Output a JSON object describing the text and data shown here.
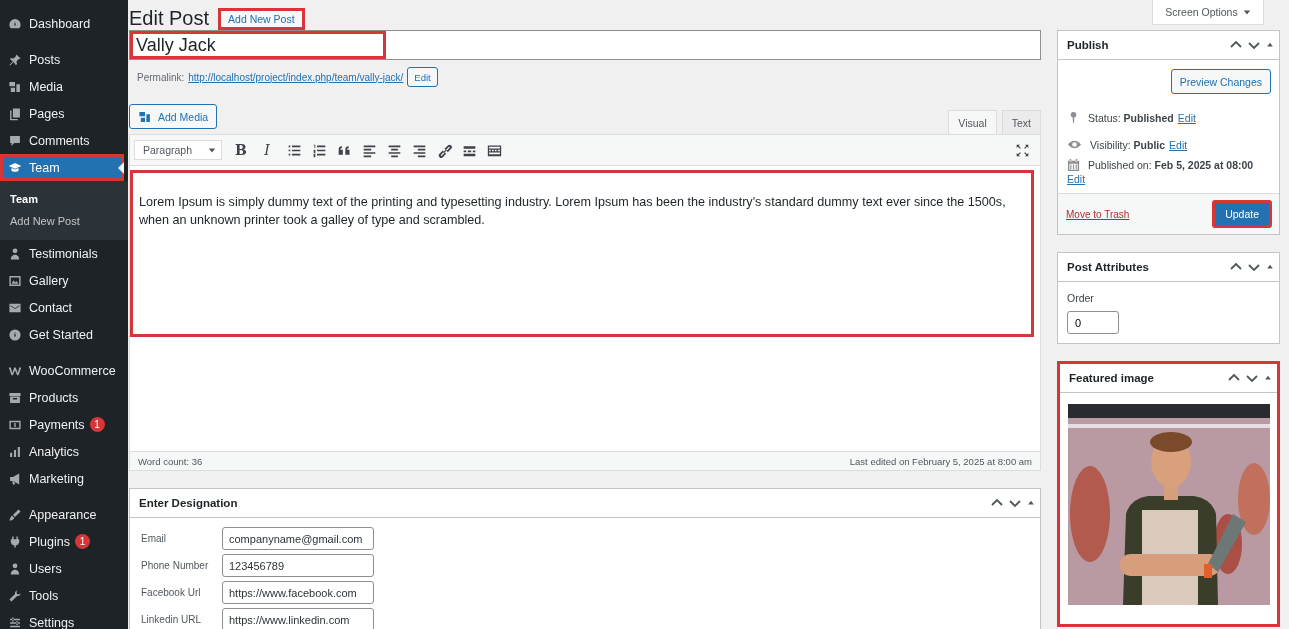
{
  "sidebar": {
    "groups": [
      [
        {
          "label": "Dashboard",
          "selected": false
        }
      ],
      [
        {
          "label": "Posts",
          "selected": false
        },
        {
          "label": "Media",
          "selected": false
        },
        {
          "label": "Pages",
          "selected": false
        },
        {
          "label": "Comments",
          "selected": false
        },
        {
          "label": "Team",
          "selected": true,
          "highlighted": true,
          "children": [
            {
              "label": "Team",
              "selected": true
            },
            {
              "label": "Add New Post",
              "selected": false
            }
          ]
        },
        {
          "label": "Testimonials",
          "selected": false
        },
        {
          "label": "Gallery",
          "selected": false
        },
        {
          "label": "Contact",
          "selected": false
        },
        {
          "label": "Get Started",
          "selected": false
        }
      ],
      [
        {
          "label": "WooCommerce",
          "selected": false
        },
        {
          "label": "Products",
          "selected": false
        },
        {
          "label": "Payments",
          "selected": false,
          "badge": "1"
        },
        {
          "label": "Analytics",
          "selected": false
        },
        {
          "label": "Marketing",
          "selected": false
        }
      ],
      [
        {
          "label": "Appearance",
          "selected": false
        },
        {
          "label": "Plugins",
          "selected": false,
          "badge": "1"
        },
        {
          "label": "Users",
          "selected": false
        },
        {
          "label": "Tools",
          "selected": false
        },
        {
          "label": "Settings",
          "selected": false
        }
      ]
    ]
  },
  "header": {
    "title": "Edit Post",
    "add_new": {
      "label": "Add New Post",
      "highlighted": true
    },
    "screen_options": "Screen Options"
  },
  "title_field": {
    "value": "Vally Jack",
    "highlighted": true
  },
  "permalink": {
    "label": "Permalink:",
    "url": "http://localhost/project/index.php/team/vally-jack/",
    "edit": "Edit"
  },
  "add_media": "Add Media",
  "editor_tabs": [
    {
      "label": "Visual",
      "selected": true
    },
    {
      "label": "Text",
      "selected": false
    }
  ],
  "toolbar": {
    "format": "Paragraph",
    "bold": "B",
    "italic": "I"
  },
  "content": {
    "text": "Lorem Ipsum is simply dummy text of the printing and typesetting industry. Lorem Ipsum has been the industry's standard dummy text ever since the 1500s, when an unknown printer took a galley of type and scrambled.",
    "highlighted": true
  },
  "status_bar": {
    "word_count": "Word count: 36",
    "last_edited": "Last edited on February 5, 2025 at 8:00 am"
  },
  "designation": {
    "title": "Enter Designation",
    "fields": [
      {
        "label": "Email",
        "value": "companyname@gmail.com"
      },
      {
        "label": "Phone Number",
        "value": "123456789"
      },
      {
        "label": "Facebook Url",
        "value": "https://www.facebook.com"
      },
      {
        "label": "Linkedin URL",
        "value": "https://www.linkedin.com"
      }
    ]
  },
  "publish": {
    "title": "Publish",
    "preview": "Preview Changes",
    "rows": [
      {
        "text": "Status: **Published**",
        "edit": "Edit"
      },
      {
        "text": "Visibility: **Public**",
        "edit": "Edit"
      },
      {
        "text": "Published on: **Feb 5, 2025 at 08:00**",
        "edit": "Edit"
      }
    ],
    "trash": "Move to Trash",
    "update": {
      "label": "Update",
      "highlighted": true
    }
  },
  "attributes": {
    "title": "Post Attributes",
    "order_label": "Order",
    "order_value": "0"
  },
  "featured": {
    "title": "Featured image",
    "highlighted": true,
    "kind": "picture"
  }
}
